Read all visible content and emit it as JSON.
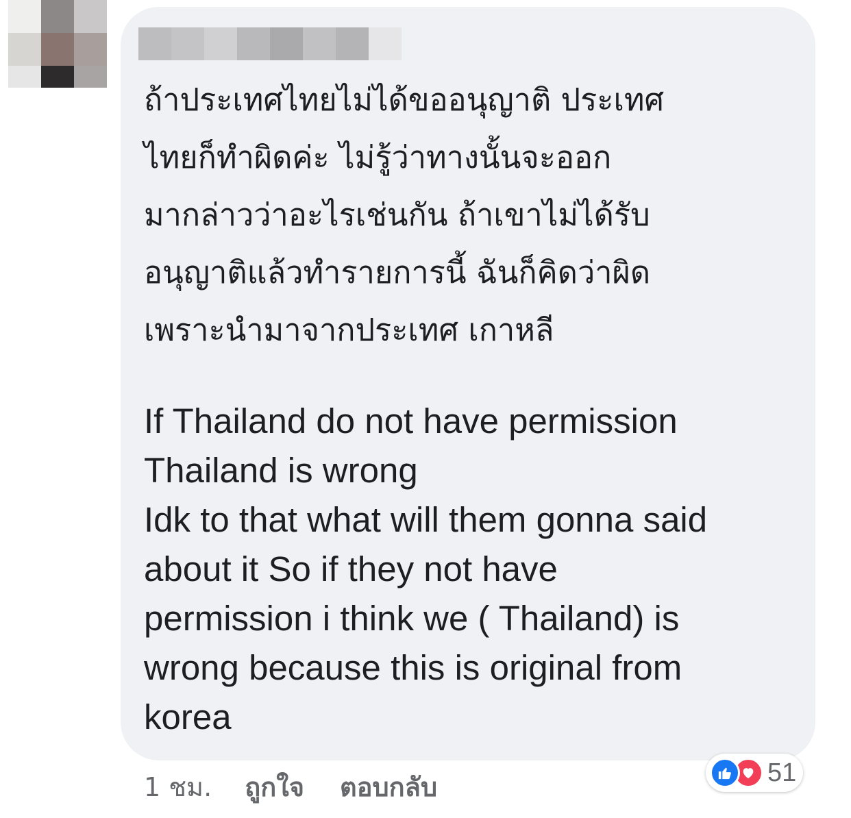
{
  "comment": {
    "thai_lines": [
      "ถ้าประเทศไทยไม่ได้ขออนุญาติ ประเทศ",
      "ไทยก็ทำผิดค่ะ ไม่รู้ว่าทางนั้นจะออก",
      "มากล่าวว่าอะไรเช่นกัน ถ้าเขาไม่ได้รับ",
      "อนุญาติแล้วทำรายการนี้ ฉันก็คิดว่าผิด",
      "เพราะนำมาจากประเทศ เกาหลี"
    ],
    "english_lines": [
      "If Thailand do not have permission",
      "Thailand is wrong",
      "Idk to that what will them gonna said",
      "about it So if they not have",
      "permission i think we ( Thailand) is",
      "wrong because this is original from",
      "korea"
    ]
  },
  "actions": {
    "time": "1 ชม.",
    "like": "ถูกใจ",
    "reply": "ตอบกลับ"
  },
  "reactions": {
    "count": "51",
    "icons": [
      "thumbs-up-icon",
      "heart-icon"
    ],
    "like_color": "#1877f2",
    "love_color": "#f33e58"
  },
  "colors": {
    "bubble_bg": "#f0f1f4",
    "text": "#1c1e21",
    "secondary_text": "#65676b"
  }
}
